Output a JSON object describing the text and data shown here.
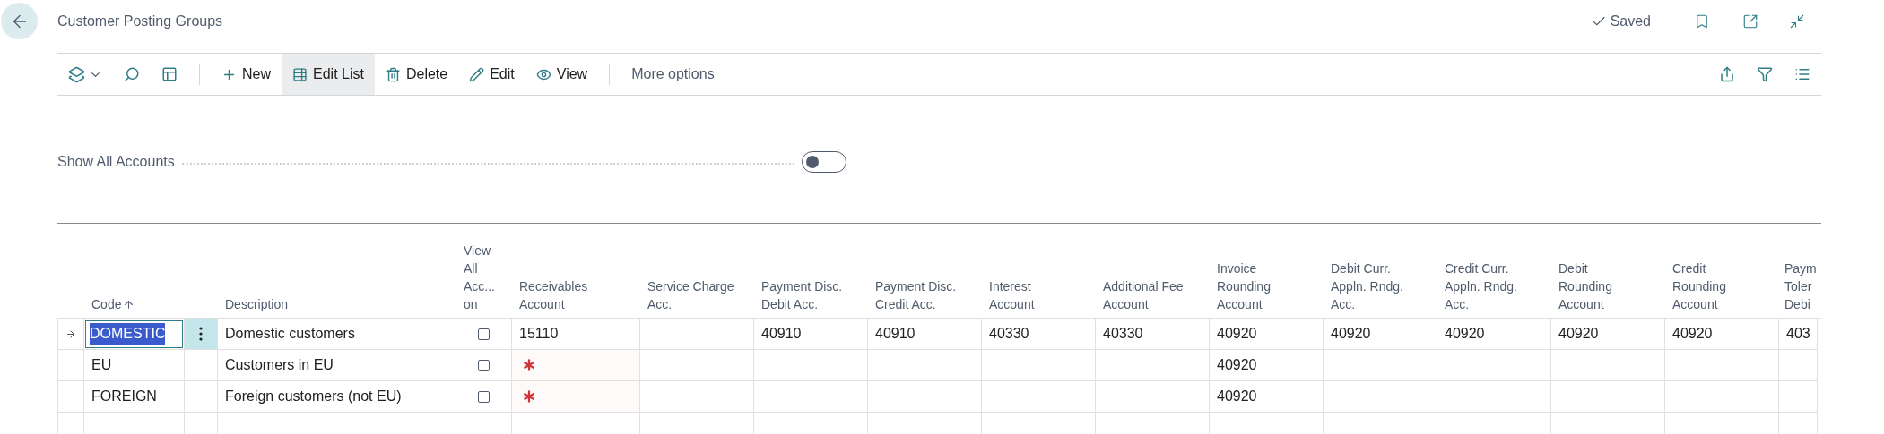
{
  "page": {
    "title": "Customer Posting Groups",
    "status": "Saved"
  },
  "toolbar": {
    "actions": [
      {
        "kind": "new",
        "label": "New",
        "selected": false
      },
      {
        "kind": "edit_list",
        "label": "Edit List",
        "selected": true
      },
      {
        "kind": "delete",
        "label": "Delete",
        "selected": false
      },
      {
        "kind": "edit",
        "label": "Edit",
        "selected": false
      },
      {
        "kind": "view",
        "label": "View",
        "selected": false
      }
    ],
    "more": "More options"
  },
  "toggle": {
    "label": "Show All Accounts",
    "on": false
  },
  "table": {
    "columns": [
      {
        "lines": [
          "Code"
        ],
        "sorted": true
      },
      {
        "lines": [
          "Description"
        ],
        "sorted": false
      },
      {
        "lines": [
          "View",
          "All",
          "Acc...",
          "on"
        ],
        "sorted": false
      },
      {
        "lines": [
          "Receivables",
          "Account"
        ],
        "sorted": false
      },
      {
        "lines": [
          "Service Charge",
          "Acc."
        ],
        "sorted": false
      },
      {
        "lines": [
          "Payment Disc.",
          "Debit Acc."
        ],
        "sorted": false
      },
      {
        "lines": [
          "Payment Disc.",
          "Credit Acc."
        ],
        "sorted": false
      },
      {
        "lines": [
          "Interest",
          "Account"
        ],
        "sorted": false
      },
      {
        "lines": [
          "Additional Fee",
          "Account"
        ],
        "sorted": false
      },
      {
        "lines": [
          "Invoice",
          "Rounding",
          "Account"
        ],
        "sorted": false
      },
      {
        "lines": [
          "Debit Curr.",
          "Appln. Rndg.",
          "Acc."
        ],
        "sorted": false
      },
      {
        "lines": [
          "Credit Curr.",
          "Appln. Rndg.",
          "Acc."
        ],
        "sorted": false
      },
      {
        "lines": [
          "Debit",
          "Rounding",
          "Account"
        ],
        "sorted": false
      },
      {
        "lines": [
          "Credit",
          "Rounding",
          "Account"
        ],
        "sorted": false
      },
      {
        "lines": [
          "Paym",
          "Toler",
          "Debi"
        ],
        "sorted": false
      }
    ],
    "rows": [
      {
        "selected": true,
        "code": "DOMESTIC",
        "description": "Domestic customers",
        "view_all": false,
        "accounts": [
          {
            "value": "15110",
            "required": false
          },
          {
            "required": false
          },
          {
            "value": "40910",
            "required": false
          },
          {
            "value": "40910",
            "required": false
          },
          {
            "value": "40330",
            "required": false
          },
          {
            "value": "40330",
            "required": false
          },
          {
            "value": "40920",
            "required": false
          },
          {
            "value": "40920",
            "required": false
          },
          {
            "value": "40920",
            "required": false
          },
          {
            "value": "40920",
            "required": false
          },
          {
            "value": "40920",
            "required": false
          },
          {
            "value": "403",
            "required": false
          }
        ]
      },
      {
        "selected": false,
        "code": "EU",
        "description": "Customers in EU",
        "view_all": false,
        "accounts": [
          {
            "required": true
          },
          {
            "required": false
          },
          {
            "required": false
          },
          {
            "required": false
          },
          {
            "required": false
          },
          {
            "required": false
          },
          {
            "value": "40920",
            "required": false
          },
          {
            "required": false
          },
          {
            "required": false
          },
          {
            "required": false
          },
          {
            "required": false
          },
          {
            "required": false
          }
        ]
      },
      {
        "selected": false,
        "code": "FOREIGN",
        "description": "Foreign customers (not EU)",
        "view_all": false,
        "accounts": [
          {
            "required": true
          },
          {
            "required": false
          },
          {
            "required": false
          },
          {
            "required": false
          },
          {
            "required": false
          },
          {
            "required": false
          },
          {
            "value": "40920",
            "required": false
          },
          {
            "required": false
          },
          {
            "required": false
          },
          {
            "required": false
          },
          {
            "required": false
          },
          {
            "required": false
          }
        ]
      }
    ]
  }
}
